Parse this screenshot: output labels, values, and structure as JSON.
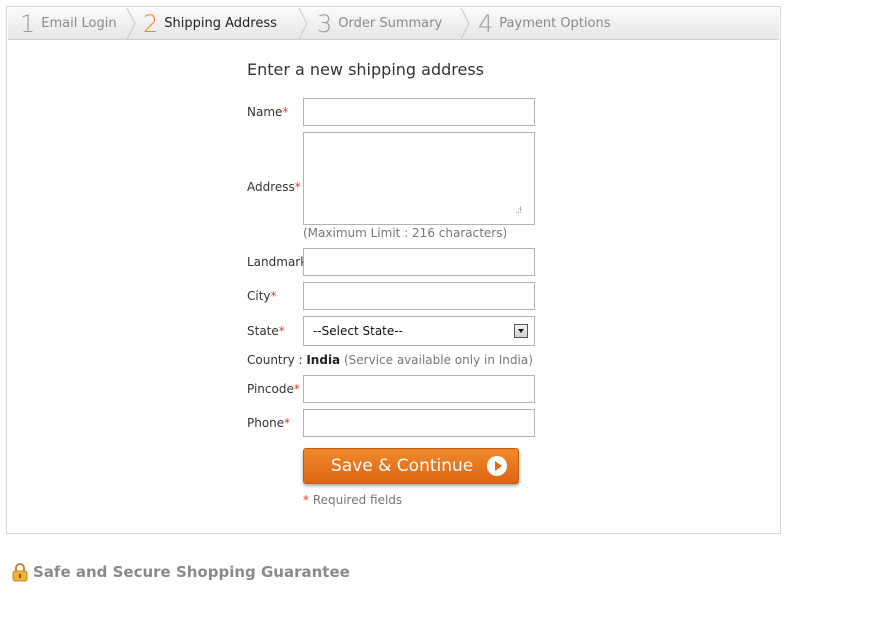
{
  "steps": [
    {
      "num": "1",
      "label": "Email Login",
      "active": false
    },
    {
      "num": "2",
      "label": "Shipping Address",
      "active": true
    },
    {
      "num": "3",
      "label": "Order Summary",
      "active": false
    },
    {
      "num": "4",
      "label": "Payment Options",
      "active": false
    }
  ],
  "form": {
    "heading": "Enter a new shipping address",
    "required_mark": "*",
    "name_label": "Name",
    "address_label": "Address",
    "address_hint": "(Maximum Limit : 216 characters)",
    "landmark_label": "Landmark",
    "city_label": "City",
    "state_label": "State",
    "state_selected": "--Select State--",
    "country_label": "Country : ",
    "country_value": "India",
    "country_note": " (Service available only in India)",
    "pincode_label": "Pincode",
    "phone_label": "Phone",
    "submit_label": "Save & Continue",
    "required_note": " Required fields"
  },
  "footer": {
    "secure_text": "Safe and Secure Shopping Guarantee"
  },
  "colors": {
    "accent": "#f08a1c",
    "button": "#e7761e",
    "required": "#e03b1f"
  }
}
